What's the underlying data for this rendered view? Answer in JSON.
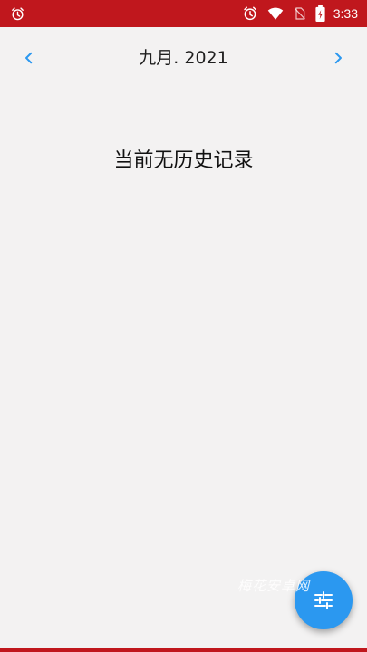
{
  "status_bar": {
    "time": "3:33",
    "colors": {
      "background": "#c0171d"
    },
    "icons": [
      "alarm-icon",
      "alarm-icon",
      "wifi-icon",
      "no-sim-icon",
      "battery-charging-icon"
    ]
  },
  "header": {
    "month_label": "九月. 2021",
    "prev_icon": "chevron-left-icon",
    "next_icon": "chevron-right-icon",
    "accent_color": "#2b98f0"
  },
  "content": {
    "empty_message": "当前无历史记录"
  },
  "watermark": {
    "text": "梅花安卓网"
  },
  "fab": {
    "icon": "sliders-icon",
    "color": "#2b98f0"
  }
}
